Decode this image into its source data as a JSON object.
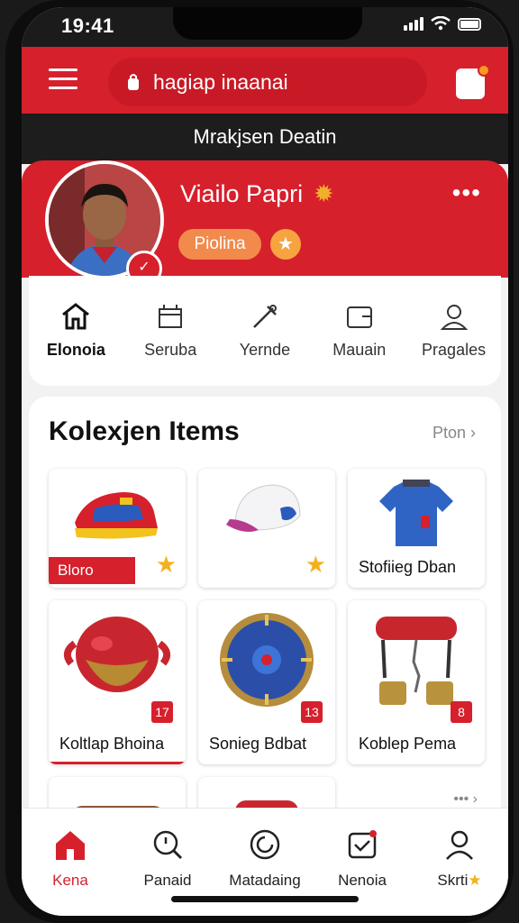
{
  "status_bar": {
    "time": "19:41"
  },
  "header": {
    "search_placeholder": "hagiap inaanai",
    "banner": "Mrakjsen Deatin"
  },
  "profile": {
    "name": "Viailo Papri",
    "tag": "Piolina",
    "more": "•••"
  },
  "quick_nav": [
    {
      "label": "Elonoia",
      "icon": "home-icon",
      "active": true
    },
    {
      "label": "Seruba",
      "icon": "shop-icon"
    },
    {
      "label": "Yernde",
      "icon": "tools-icon"
    },
    {
      "label": "Mauain",
      "icon": "wallet-icon"
    },
    {
      "label": "Pragales",
      "icon": "user-icon"
    }
  ],
  "collection": {
    "title": "Kolexjen Items",
    "more": "Pton",
    "items": [
      {
        "icon": "sneaker-icon",
        "tag": "Bloro",
        "starred": true
      },
      {
        "icon": "cap-icon",
        "starred": true
      },
      {
        "icon": "jersey-icon",
        "label": "Stofiieg Dban"
      },
      {
        "icon": "helmet-icon",
        "label": "Koltlap Bhoina",
        "badge": "17"
      },
      {
        "icon": "shield-icon",
        "label": "Sonieg Bdbat",
        "badge": "13"
      },
      {
        "icon": "dumbbell-icon",
        "label": "Koblep Pema",
        "badge": "8"
      }
    ],
    "more_dots": "•••"
  },
  "tab_bar": [
    {
      "label": "Kena",
      "icon": "home-icon",
      "active": true
    },
    {
      "label": "Panaid",
      "icon": "search-icon"
    },
    {
      "label": "Matadaing",
      "icon": "target-icon"
    },
    {
      "label": "Nenoia",
      "icon": "inbox-icon"
    },
    {
      "label": "Skrti",
      "icon": "profile-icon"
    }
  ],
  "colors": {
    "primary": "#d6202c",
    "accent": "#f2b21d",
    "banner": "#1d1d1d"
  }
}
